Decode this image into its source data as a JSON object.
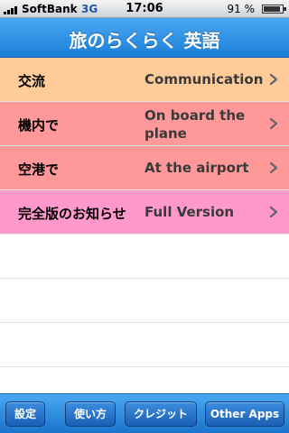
{
  "status_bar": {
    "carrier": "SoftBank",
    "network": "3G",
    "time": "17:06",
    "battery_text": "91 %",
    "battery_level": 0.91
  },
  "navbar": {
    "title": "旅のらくらく 英語"
  },
  "menu": [
    {
      "ja": "交流",
      "en": "Communication",
      "color": "#ffcc99"
    },
    {
      "ja": "機内で",
      "en": "On board the plane",
      "color": "#ff9999"
    },
    {
      "ja": "空港で",
      "en": "At the airport",
      "color": "#ff9999"
    },
    {
      "ja": "完全版のお知らせ",
      "en": "Full Version",
      "color": "#ff99cc"
    }
  ],
  "toolbar": {
    "settings": "設定",
    "how_to": "使い方",
    "credits": "クレジット",
    "other_apps": "Other Apps"
  },
  "colors": {
    "nav_blue": "#2a8ee6",
    "chevron": "#666666"
  }
}
